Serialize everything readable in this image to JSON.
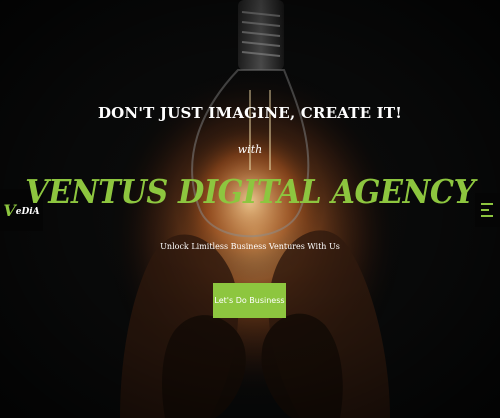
{
  "brand": {
    "logo_main": "V",
    "logo_small": "eDiA",
    "accent_color": "#8dc63f"
  },
  "hero": {
    "headline": "DON'T JUST IMAGINE, CREATE IT!",
    "connector": "with",
    "agency_name": "VENTUS DIGITAL AGENCY",
    "subtitle": "Unlock Limitless Business Ventures With Us",
    "cta_label": "Let's Do Business"
  },
  "nav": {
    "menu_icon": "hamburger-menu-icon"
  }
}
